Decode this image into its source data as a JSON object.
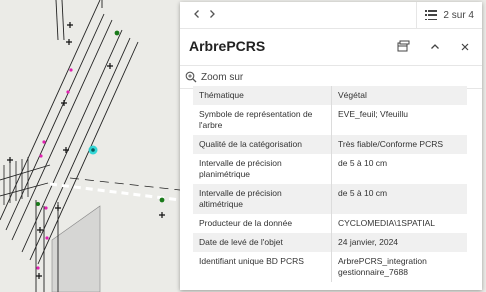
{
  "popup": {
    "pager": "2 sur 4",
    "title": "ArbrePCRS",
    "zoom_label": "Zoom sur",
    "attributes": [
      {
        "label": "Thématique",
        "value": "Végétal"
      },
      {
        "label": "Symbole de représentation de l'arbre",
        "value": "EVE_feuil; Vfeuillu"
      },
      {
        "label": "Qualité de la catégorisation",
        "value": "Très fiable/Conforme PCRS"
      },
      {
        "label": "Intervalle de précision planimétrique",
        "value": "de 5 à 10 cm"
      },
      {
        "label": "Intervalle de précision altimétrique",
        "value": "de 5 à 10 cm"
      },
      {
        "label": "Producteur de la donnée",
        "value": "CYCLOMEDIA\\1SPATIAL"
      },
      {
        "label": "Date de levé de l'objet",
        "value": "24 janvier, 2024"
      },
      {
        "label": "Identifiant unique BD PCRS",
        "value": "ArbrePCRS_integration gestionnaire_7688"
      }
    ]
  },
  "icons": {
    "prev": "chevron-left-icon",
    "next": "chevron-right-icon",
    "list": "list-icon",
    "dock": "dock-icon",
    "collapse": "chevron-up-icon",
    "close": "close-icon",
    "zoom": "zoom-in-icon"
  },
  "colors": {
    "map_background": "#ebebe7",
    "map_lines": "#222222",
    "selected_marker": "#20d4d4",
    "magenta_points": "#e020b0",
    "green_points": "#1a7a1a"
  }
}
